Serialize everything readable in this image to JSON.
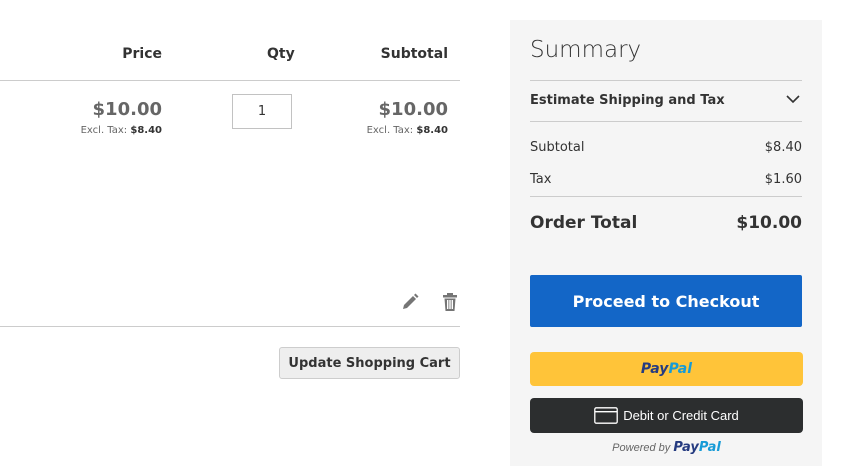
{
  "cart": {
    "headers": {
      "price": "Price",
      "qty": "Qty",
      "subtotal": "Subtotal"
    },
    "item": {
      "price": "$10.00",
      "price_excl_label": "Excl. Tax:",
      "price_excl_value": "$8.40",
      "qty": "1",
      "subtotal": "$10.00",
      "subtotal_excl_label": "Excl. Tax:",
      "subtotal_excl_value": "$8.40"
    },
    "actions": {
      "edit_icon": "pencil-icon",
      "delete_icon": "trash-icon"
    },
    "update_button": "Update Shopping Cart"
  },
  "summary": {
    "title": "Summary",
    "estimate": "Estimate Shipping and Tax",
    "subtotal_label": "Subtotal",
    "subtotal_value": "$8.40",
    "tax_label": "Tax",
    "tax_value": "$1.60",
    "order_total_label": "Order Total",
    "order_total_value": "$10.00",
    "checkout_button": "Proceed to Checkout",
    "paypal": {
      "logo_a": "Pay",
      "logo_b": "Pal"
    },
    "card_button": "Debit or Credit Card",
    "powered_by": "Powered by"
  },
  "colors": {
    "checkout_bg": "#1366c7",
    "paypal_yellow": "#ffc439",
    "paypal_navy": "#253b80",
    "paypal_blue": "#179bd7",
    "card_button_bg": "#2c2e2f",
    "summary_bg": "#f5f5f5"
  }
}
